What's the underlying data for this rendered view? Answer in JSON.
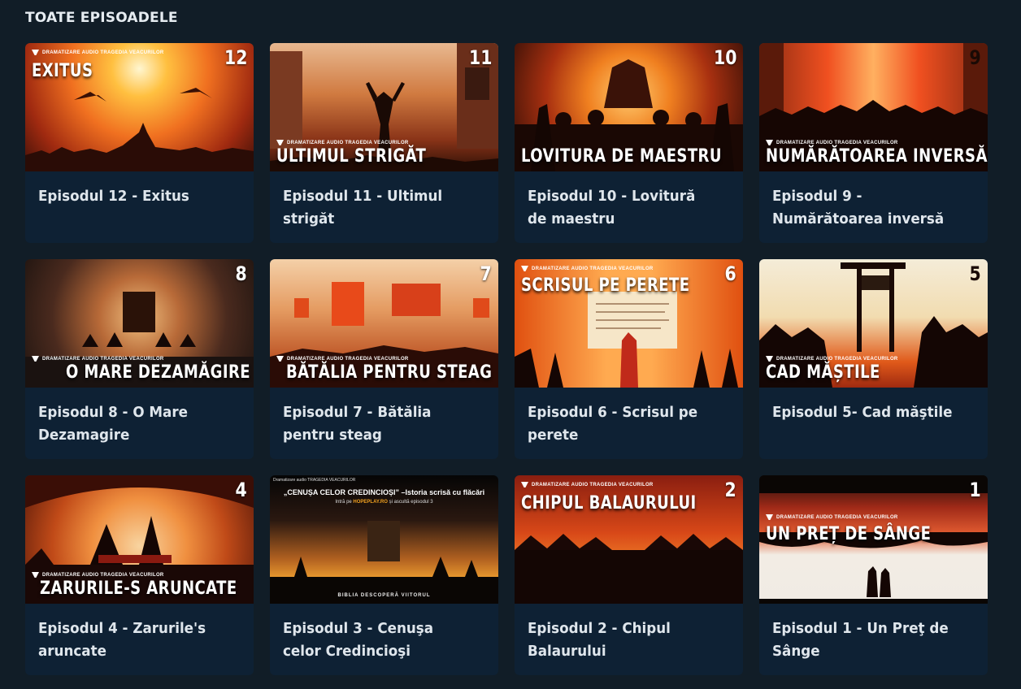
{
  "section": {
    "title": "TOATE EPISOADELE"
  },
  "brand_label": "DRAMATIZARE AUDIO TRAGEDIA VEACURILOR",
  "episodes": [
    {
      "number": "12",
      "thumb_title": "EXITUS",
      "title": "Episodul 12 - Exitus"
    },
    {
      "number": "11",
      "thumb_title": "ULTIMUL STRIGĂT",
      "title": "Episodul 11 - Ultimul strigăt"
    },
    {
      "number": "10",
      "thumb_title": "LOVITURA DE MAESTRU",
      "title": "Episodul 10 - Lovitură de maestru"
    },
    {
      "number": "9",
      "thumb_title": "NUMĂRĂTOAREA INVERSĂ",
      "title": "Episodul 9 - Numărătoarea inversă"
    },
    {
      "number": "8",
      "thumb_title": "O MARE DEZAMĂGIRE",
      "title": "Episodul 8 - O Mare Dezamagire"
    },
    {
      "number": "7",
      "thumb_title": "BĂTĂLIA PENTRU STEAG",
      "title": "Episodul 7 - Bătălia pentru steag"
    },
    {
      "number": "6",
      "thumb_title": "SCRISUL PE PERETE",
      "title": "Episodul 6 - Scrisul pe perete"
    },
    {
      "number": "5",
      "thumb_title": "CAD MĂȘTILE",
      "title": "Episodul 5- Cad măştile"
    },
    {
      "number": "4",
      "thumb_title": "ZARURILE-S ARUNCATE",
      "title": "Episodul 4 - Zarurile's aruncate"
    },
    {
      "number": "",
      "thumb_title": "",
      "title": "Episodul 3 - Cenuşa celor Credincioşi",
      "promo": {
        "brand": "Dramatizare audio TRAGEDIA VEACURILOR",
        "headline": "„CENUȘA CELOR CREDINCIOȘI” –Istoria scrisă cu flăcări",
        "sub_prefix": "Intră pe",
        "sub_site": "HOPEPLAY.RO",
        "sub_suffix": "și ascultă episodul 3",
        "footer": "BIBLIA DESCOPERĂ VIITORUL"
      }
    },
    {
      "number": "2",
      "thumb_title": "CHIPUL BALAURULUI",
      "title": "Episodul 2 - Chipul Balaurului"
    },
    {
      "number": "1",
      "thumb_title": "UN PREȚ DE SÂNGE",
      "title": "Episodul 1 - Un Preţ de Sânge"
    }
  ],
  "colors": {
    "page_bg": "#111d27",
    "card_bg": "#0e2134",
    "accent_orange": "#f08020"
  }
}
